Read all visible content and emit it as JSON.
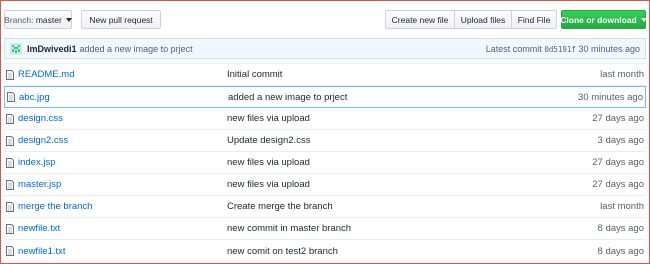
{
  "toolbar": {
    "branch_prefix": "Branch:",
    "branch_value": "master",
    "new_pull_request": "New pull request",
    "create_new_file": "Create new file",
    "upload_files": "Upload files",
    "find_file": "Find File",
    "clone_or_download": "Clone or download"
  },
  "latest_commit": {
    "user": "ImDwivedi1",
    "message": "added a new image to prject",
    "label": "Latest commit",
    "sha": "0d5191f",
    "age": "30 minutes ago"
  },
  "files": [
    {
      "name": "README.md",
      "message": "Initial commit",
      "age": "last month"
    },
    {
      "name": "abc.jpg",
      "message": "added a new image to prject",
      "age": "30 minutes ago"
    },
    {
      "name": "design.css",
      "message": "new files via upload",
      "age": "27 days ago"
    },
    {
      "name": "design2.css",
      "message": "Update design2.css",
      "age": "3 days ago"
    },
    {
      "name": "index.jsp",
      "message": "new files via upload",
      "age": "27 days ago"
    },
    {
      "name": "master.jsp",
      "message": "new files via upload",
      "age": "27 days ago"
    },
    {
      "name": "merge the branch",
      "message": "Create merge the branch",
      "age": "last month"
    },
    {
      "name": "newfile.txt",
      "message": "new commit in master branch",
      "age": "8 days ago"
    },
    {
      "name": "newfile1.txt",
      "message": "new comit on test2 branch",
      "age": "8 days ago"
    }
  ],
  "colors": {
    "link": "#0366d6",
    "clone_button": "#28a745",
    "commit_bar_bg": "#f1f8ff",
    "frame_border": "#d9534f"
  },
  "icons": {
    "file": "file-icon",
    "avatar": "user-avatar-icon",
    "caret": "caret-down-icon"
  }
}
